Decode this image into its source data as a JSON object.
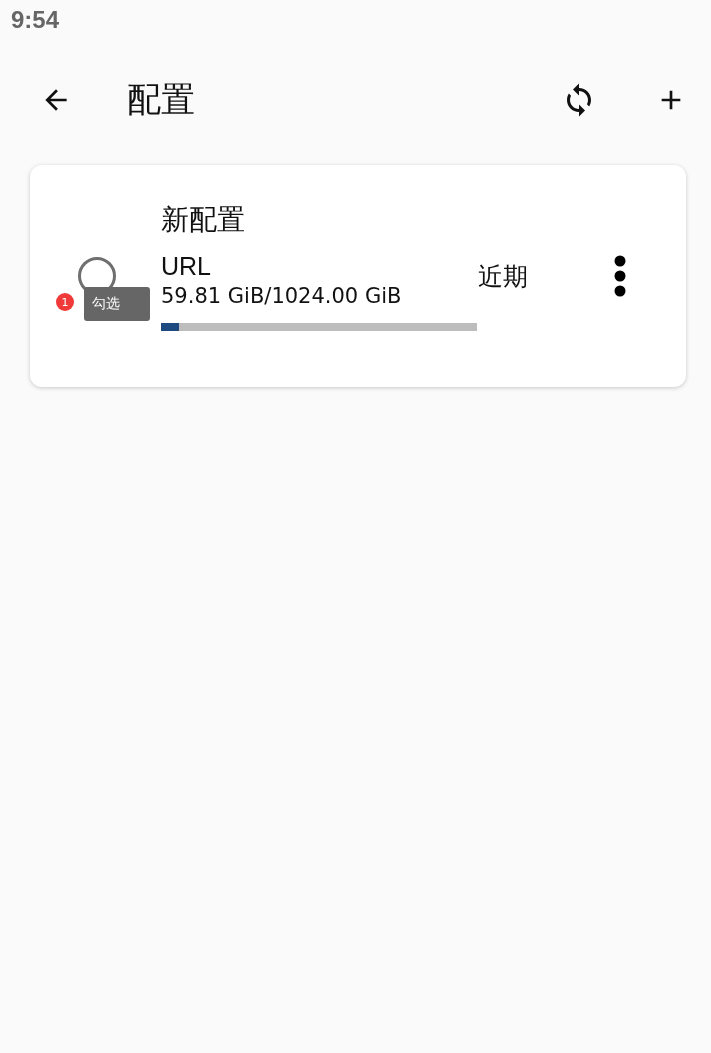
{
  "status_bar": {
    "time": "9:54"
  },
  "toolbar": {
    "title": "配置"
  },
  "profiles": [
    {
      "name": "新配置",
      "type": "URL",
      "usage": "59.81 GiB/1024.00 GiB",
      "level": 0.058,
      "updated": "近期",
      "selected": false
    }
  ],
  "hint": {
    "badge": "1",
    "text": "勾选"
  }
}
